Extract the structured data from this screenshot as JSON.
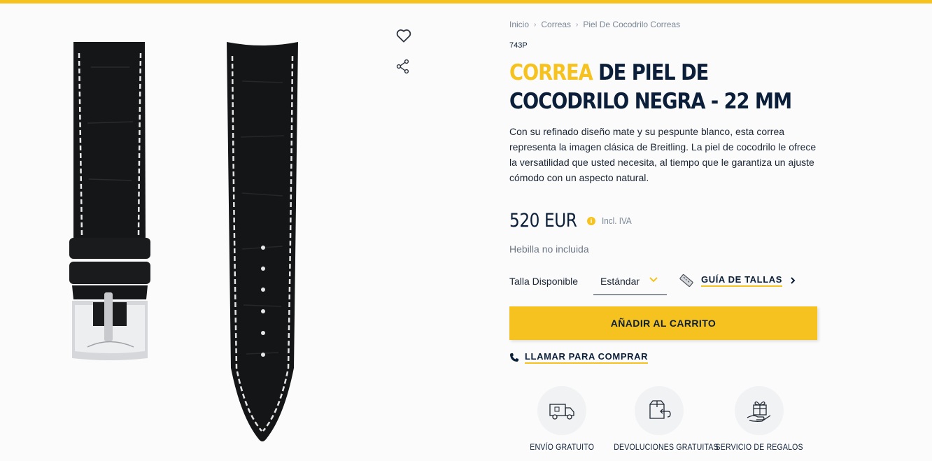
{
  "brand": {
    "accent_color": "#f6c21f",
    "primary_color": "#0b1f3a"
  },
  "actions": {
    "favorite_icon": "heart-icon",
    "share_icon": "share-icon"
  },
  "breadcrumb": {
    "items": [
      "Inicio",
      "Correas",
      "Piel De Cocodrilo Correas"
    ],
    "separator_icon": "chevron-right-icon"
  },
  "product": {
    "sku": "743P",
    "title_accent": "CORREA",
    "title_rest": " DE PIEL DE COCODRILO NEGRA - 22 MM",
    "description": "Con su refinado diseño mate y su pespunte blanco, esta correa representa la imagen clásica de Breitling. La piel de cocodrilo le ofrece la versatilidad que usted necesita, al tiempo que le garantiza un ajuste cómodo con un aspecto natural.",
    "price": "520 EUR",
    "vat_note": "Incl. IVA",
    "info_icon_glyph": "i",
    "buckle_note": "Hebilla no incluida"
  },
  "size": {
    "label": "Talla Disponible",
    "selected": "Estándar",
    "guide_label": "GUÍA DE TALLAS"
  },
  "cart": {
    "add_label": "AÑADIR AL CARRITO"
  },
  "call": {
    "label": "LLAMAR PARA COMPRAR"
  },
  "services": [
    {
      "label": "ENVÍO GRATUITO",
      "icon": "truck-icon"
    },
    {
      "label": "DEVOLUCIONES GRATUITAS",
      "icon": "return-box-icon"
    },
    {
      "label": "SERVICIO DE REGALOS",
      "icon": "gift-icon"
    }
  ]
}
